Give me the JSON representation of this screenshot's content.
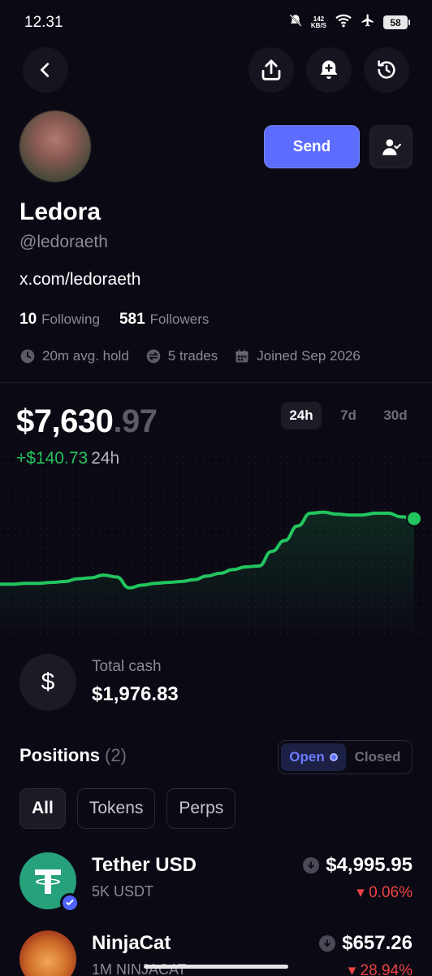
{
  "status_bar": {
    "time": "12.31",
    "net_speed_value": "142",
    "net_speed_unit": "KB/S",
    "battery": "58"
  },
  "header": {
    "icons": [
      "back-icon",
      "share-icon",
      "bell-plus-icon",
      "history-icon"
    ]
  },
  "profile": {
    "send_label": "Send",
    "name": "Ledora",
    "handle": "@ledoraeth",
    "link": "x.com/ledoraeth",
    "following_count": "10",
    "following_label": "Following",
    "followers_count": "581",
    "followers_label": "Followers",
    "avg_hold": "20m avg. hold",
    "trades": "5 trades",
    "joined": "Joined Sep 2026"
  },
  "portfolio": {
    "balance_main": "$7,630",
    "balance_cents": ".97",
    "change_value": "+$140.73",
    "change_period": "24h",
    "ranges": [
      "24h",
      "7d",
      "30d"
    ],
    "active_range": "24h",
    "colors": {
      "line": "#22c55e"
    }
  },
  "chart_data": {
    "type": "line",
    "title": "",
    "xlabel": "",
    "ylabel": "",
    "grid": false,
    "points": [
      0.14,
      0.14,
      0.15,
      0.15,
      0.16,
      0.17,
      0.2,
      0.21,
      0.24,
      0.22,
      0.1,
      0.13,
      0.15,
      0.16,
      0.17,
      0.19,
      0.23,
      0.26,
      0.3,
      0.33,
      0.34,
      0.5,
      0.62,
      0.78,
      0.92,
      0.93,
      0.91,
      0.9,
      0.9,
      0.92,
      0.92,
      0.88,
      0.86
    ]
  },
  "cash": {
    "label": "Total cash",
    "value": "$1,976.83"
  },
  "positions": {
    "title": "Positions",
    "count": "(2)",
    "open_label": "Open",
    "closed_label": "Closed",
    "filters": [
      "All",
      "Tokens",
      "Perps"
    ],
    "items": [
      {
        "name": "Tether USD",
        "amount": "5K USDT",
        "value": "$4,995.95",
        "change": "▾ 0.06%"
      },
      {
        "name": "NinjaCat",
        "amount": "1M NINJACAT",
        "value": "$657.26",
        "change": "▾ 28.94%"
      }
    ]
  }
}
